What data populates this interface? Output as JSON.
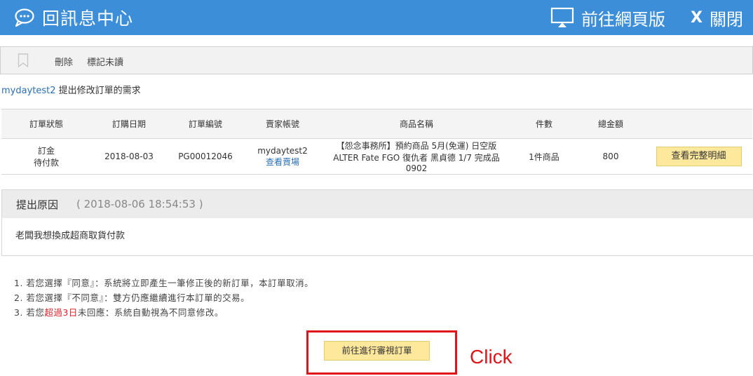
{
  "header": {
    "title": "回訊息中心",
    "web_label": "前往網頁版",
    "close_x": "X",
    "close_label": "關閉"
  },
  "toolbar": {
    "delete_label": "刪除",
    "mark_unread_label": "標記未讀"
  },
  "request": {
    "user": "mydaytest2",
    "text": "提出修改訂單的需求"
  },
  "table": {
    "headers": [
      "訂單狀態",
      "訂購日期",
      "訂單編號",
      "賣家帳號",
      "商品名稱",
      "件數",
      "總金額"
    ],
    "row": {
      "status_line1": "訂金",
      "status_line2": "待付款",
      "date": "2018-08-03",
      "order_no": "PG00012046",
      "seller": "mydaytest2",
      "seller_link": "查看賣場",
      "product_line1": "【怨念事務所】預約商品 5月(免運) 日空版",
      "product_line2": "ALTER Fate FGO 復仇者 黑貞德 1/7 完成品 0902",
      "qty": "1件商品",
      "total": "800",
      "detail_button": "查看完整明細"
    }
  },
  "reason": {
    "heading": "提出原因",
    "timestamp": "( 2018-08-06 18:54:53 )",
    "body": "老闆我想換成超商取貨付款"
  },
  "notes": {
    "n1": "1. 若您選擇『同意』：系統將立即產生一筆修正後的新訂單，本訂單取消。",
    "n2": "2. 若您選擇『不同意』：雙方仍應繼續進行本訂單的交易。",
    "n3_pre": "3. 若您",
    "n3_hl": "超過3日",
    "n3_post": "未回應：系統自動視為不同意修改。"
  },
  "review_button": "前往進行審視訂單",
  "annotation": "Click",
  "colors": {
    "header_bg": "#3d8ed8",
    "link": "#2a6fb6",
    "price": "#d9212b",
    "button_yellow": "#fde89c",
    "annotation_red": "#e0141b"
  },
  "icons": {
    "header_left": "chat-bubble-icon",
    "header_web": "monitor-icon",
    "toolbar": "bookmark-icon"
  }
}
